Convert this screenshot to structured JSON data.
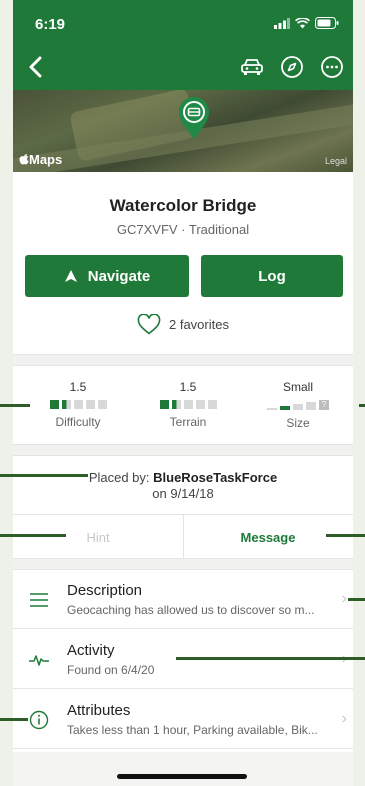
{
  "status": {
    "time": "6:19"
  },
  "map": {
    "logo": "Maps",
    "legal": "Legal"
  },
  "cache": {
    "name": "Watercolor Bridge",
    "meta": "GC7XVFV · Traditional"
  },
  "actions": {
    "navigate_label": "Navigate",
    "log_label": "Log"
  },
  "favorites": {
    "text": "2 favorites"
  },
  "stats": {
    "difficulty": {
      "value": "1.5",
      "label": "Difficulty"
    },
    "terrain": {
      "value": "1.5",
      "label": "Terrain"
    },
    "size": {
      "value": "Small",
      "label": "Size"
    }
  },
  "placed": {
    "prefix": "Placed by:",
    "owner": "BlueRoseTaskForce",
    "date": "on 9/14/18"
  },
  "tabs": {
    "hint": "Hint",
    "message": "Message"
  },
  "rows": [
    {
      "title": "Description",
      "subtitle": "Geocaching has allowed us to discover so m..."
    },
    {
      "title": "Activity",
      "subtitle": "Found on 6/4/20"
    },
    {
      "title": "Attributes",
      "subtitle": "Takes less than 1 hour, Parking available, Bik..."
    }
  ],
  "colors": {
    "brand": "#1f7a3a",
    "annotation": "#2e5e28"
  },
  "icons": [
    "back-icon",
    "car-icon",
    "compass-icon",
    "more-icon",
    "cache-pin-icon",
    "navigate-arrow-icon",
    "heart-icon",
    "list-icon",
    "activity-pulse-icon",
    "info-icon",
    "chevron-right-icon"
  ]
}
